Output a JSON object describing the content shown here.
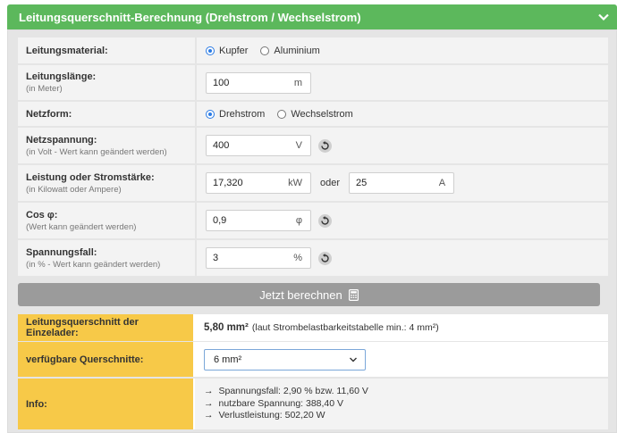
{
  "header": {
    "title": "Leitungsquerschnitt-Berechnung (Drehstrom / Wechselstrom)"
  },
  "form": {
    "material": {
      "label": "Leitungsmaterial:",
      "options": [
        "Kupfer",
        "Aluminium"
      ],
      "selected": "Kupfer"
    },
    "length": {
      "label": "Leitungslänge:",
      "sublabel": "(in Meter)",
      "value": "100",
      "unit": "m"
    },
    "network": {
      "label": "Netzform:",
      "options": [
        "Drehstrom",
        "Wechselstrom"
      ],
      "selected": "Drehstrom"
    },
    "voltage": {
      "label": "Netzspannung:",
      "sublabel": "(in Volt - Wert kann geändert werden)",
      "value": "400",
      "unit": "V"
    },
    "power": {
      "label": "Leistung oder Stromstärke:",
      "sublabel": "(in Kilowatt oder Ampere)",
      "value_kw": "17,320",
      "unit_kw": "kW",
      "oder": "oder",
      "value_a": "25",
      "unit_a": "A"
    },
    "cosphi": {
      "label": "Cos φ:",
      "sublabel": "(Wert kann geändert werden)",
      "value": "0,9",
      "unit": "φ"
    },
    "drop": {
      "label": "Spannungsfall:",
      "sublabel": "(in % - Wert kann geändert werden)",
      "value": "3",
      "unit": "%"
    },
    "submit": {
      "label": "Jetzt berechnen"
    }
  },
  "results": {
    "cross_section": {
      "label": "Leitungsquerschnitt der Einzelader:",
      "value": "5,80 mm²",
      "note": "(laut Strombelastbarkeitstabelle min.: 4 mm²)"
    },
    "available": {
      "label": "verfügbare Querschnitte:",
      "selected": "6 mm²"
    },
    "info": {
      "label": "Info:",
      "lines": [
        "Spannungsfall: 2,90 % bzw. 11,60 V",
        "nutzbare Spannung: 388,40 V",
        "Verlustleistung: 502,20 W"
      ]
    }
  },
  "colors": {
    "header": "#5cb85c",
    "result_label": "#f7c948",
    "button": "#9b9b9b",
    "radio_active": "#2b7be4"
  }
}
